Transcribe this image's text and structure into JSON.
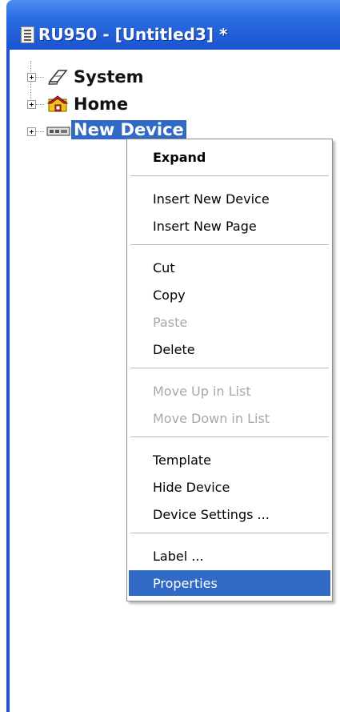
{
  "window": {
    "title": "RU950 - [Untitled3] *"
  },
  "tree": {
    "nodes": [
      {
        "label": "System",
        "icon": "eraser-icon"
      },
      {
        "label": "Home",
        "icon": "home-icon"
      },
      {
        "label": "New Device",
        "icon": "device-icon",
        "selected": true
      }
    ]
  },
  "context_menu": {
    "items": {
      "expand": "Expand",
      "insert_device": "Insert New Device",
      "insert_page": "Insert New Page",
      "cut": "Cut",
      "copy": "Copy",
      "paste": "Paste",
      "delete": "Delete",
      "move_up": "Move Up in List",
      "move_down": "Move Down in List",
      "template": "Template",
      "hide_device": "Hide Device",
      "device_settings": "Device Settings ...",
      "label": "Label ...",
      "properties": "Properties"
    }
  },
  "colors": {
    "title_bar": "#2a6ae0",
    "selection": "#316ac5",
    "disabled_text": "#a8a8a8"
  }
}
